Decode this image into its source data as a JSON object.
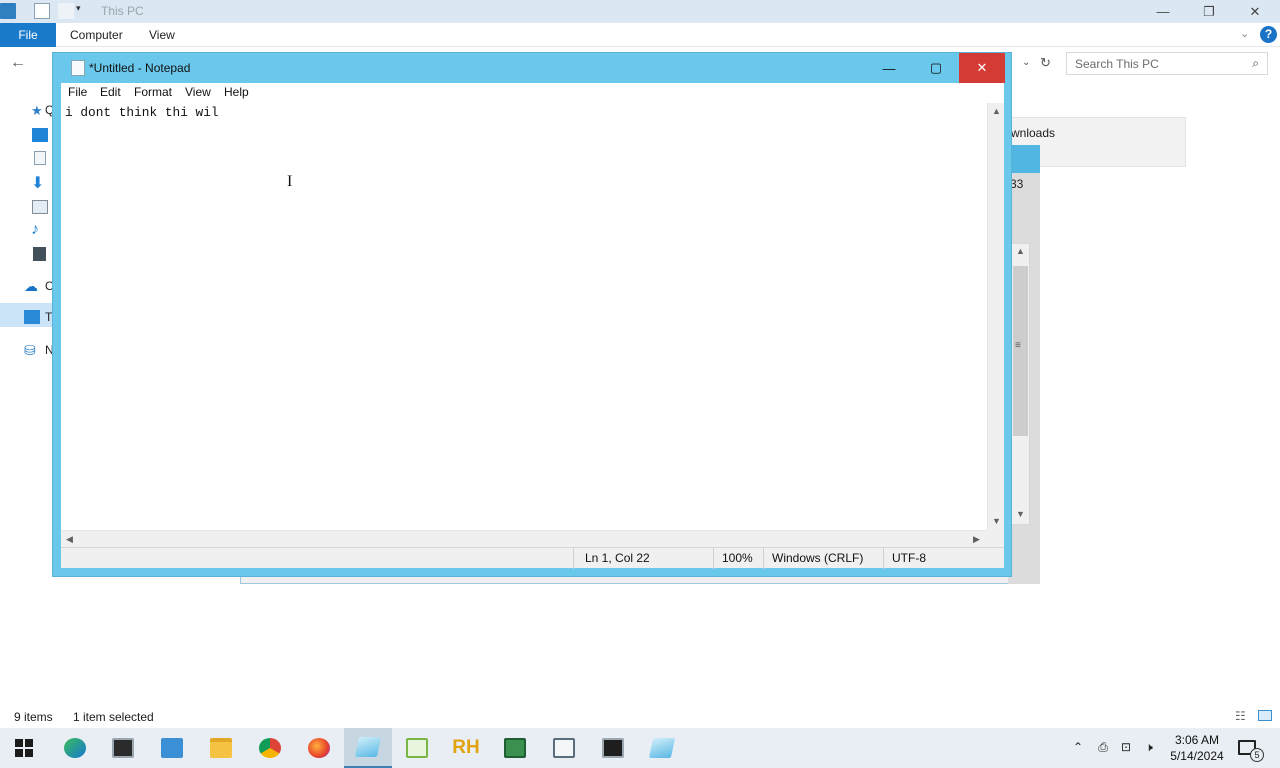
{
  "explorer": {
    "title": "This PC",
    "ribbon_tabs": [
      "File",
      "Computer",
      "View"
    ],
    "search_placeholder": "Search This PC",
    "nav_items": [
      "Q",
      "O",
      "T",
      "N"
    ],
    "downloads_label": "wnloads",
    "back_window_text": "33",
    "status": {
      "items": "9 items",
      "selected": "1 item selected"
    }
  },
  "notepad": {
    "title": "*Untitled - Notepad",
    "menu": [
      "File",
      "Edit",
      "Format",
      "View",
      "Help"
    ],
    "text": "i dont think thi wil",
    "status": {
      "position": "Ln 1, Col 22",
      "zoom": "100%",
      "line_endings": "Windows (CRLF)",
      "encoding": "UTF-8"
    },
    "window_buttons": {
      "minimize": "—",
      "maximize": "▢",
      "close": "✕"
    }
  },
  "taskbar": {
    "apps": [
      "start",
      "edge",
      "terminal",
      "server-manager",
      "file-explorer",
      "chrome",
      "firefox",
      "notepad",
      "notepad-plus",
      "rh",
      "task-manager",
      "remote-desktop",
      "cmd",
      "notepad-2"
    ],
    "rh_label": "RH",
    "clock": {
      "time": "3:06 AM",
      "date": "5/14/2024"
    },
    "notification_count": "5"
  },
  "colors": {
    "notepad_frame": "#6ac8ec",
    "close_button": "#d43b35",
    "ribbon_file": "#1979ca",
    "taskbar": "#e8eef3"
  }
}
